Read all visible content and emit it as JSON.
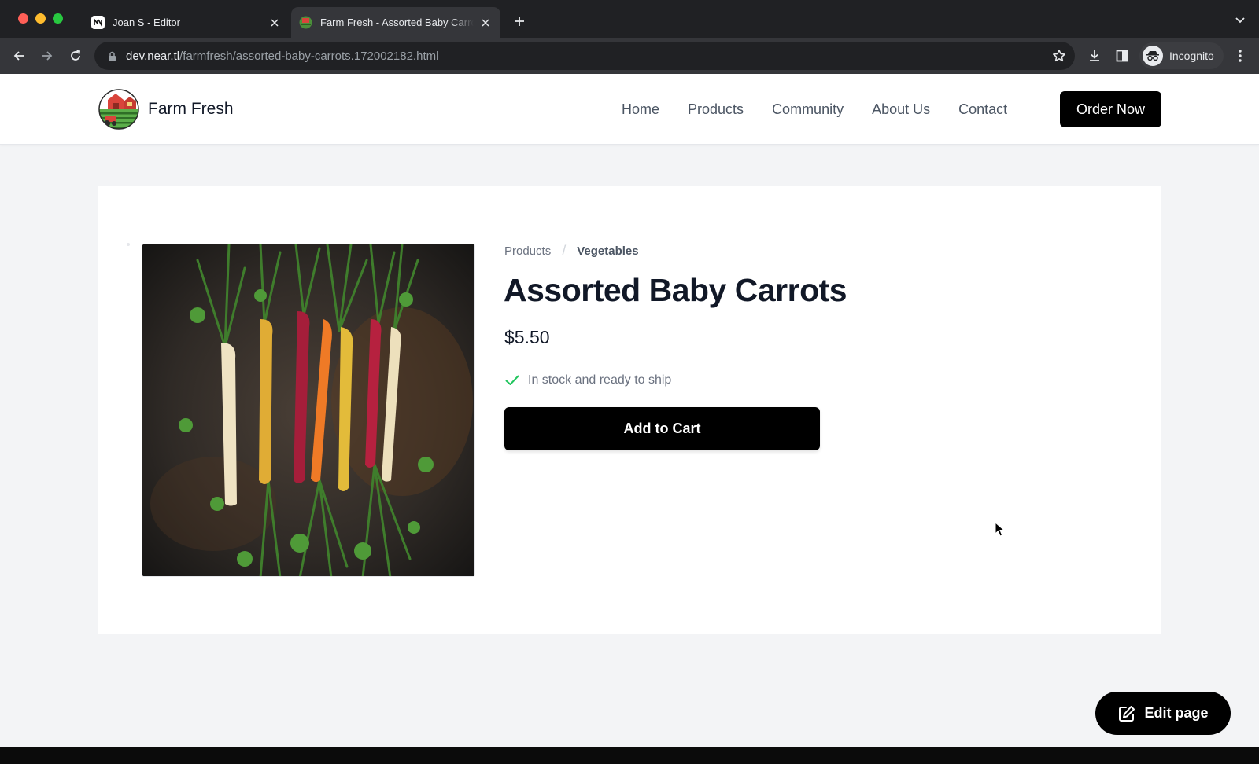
{
  "browser": {
    "tabs": [
      {
        "title": "Joan S - Editor",
        "active": false,
        "icon": "near-logo-icon"
      },
      {
        "title": "Farm Fresh - Assorted Baby Carrots",
        "active": true,
        "icon": "farm-favicon-icon"
      }
    ],
    "address": {
      "host": "dev.near.tl",
      "path": "/farmfresh/assorted-baby-carrots.172002182.html"
    },
    "profile_label": "Incognito"
  },
  "site": {
    "brand_name": "Farm Fresh",
    "nav": [
      "Home",
      "Products",
      "Community",
      "About Us",
      "Contact"
    ],
    "cta_label": "Order Now"
  },
  "product": {
    "breadcrumb": [
      "Products",
      "Vegetables"
    ],
    "breadcrumb_separator": "/",
    "title": "Assorted Baby Carrots",
    "price": "$5.50",
    "stock_text": "In stock and ready to ship",
    "add_to_cart_label": "Add to Cart",
    "image_icon": "carrots-photo"
  },
  "editor": {
    "edit_label": "Edit page"
  },
  "colors": {
    "accent": "#000000",
    "stock_check": "#22c55e",
    "page_bg": "#f3f4f6"
  }
}
